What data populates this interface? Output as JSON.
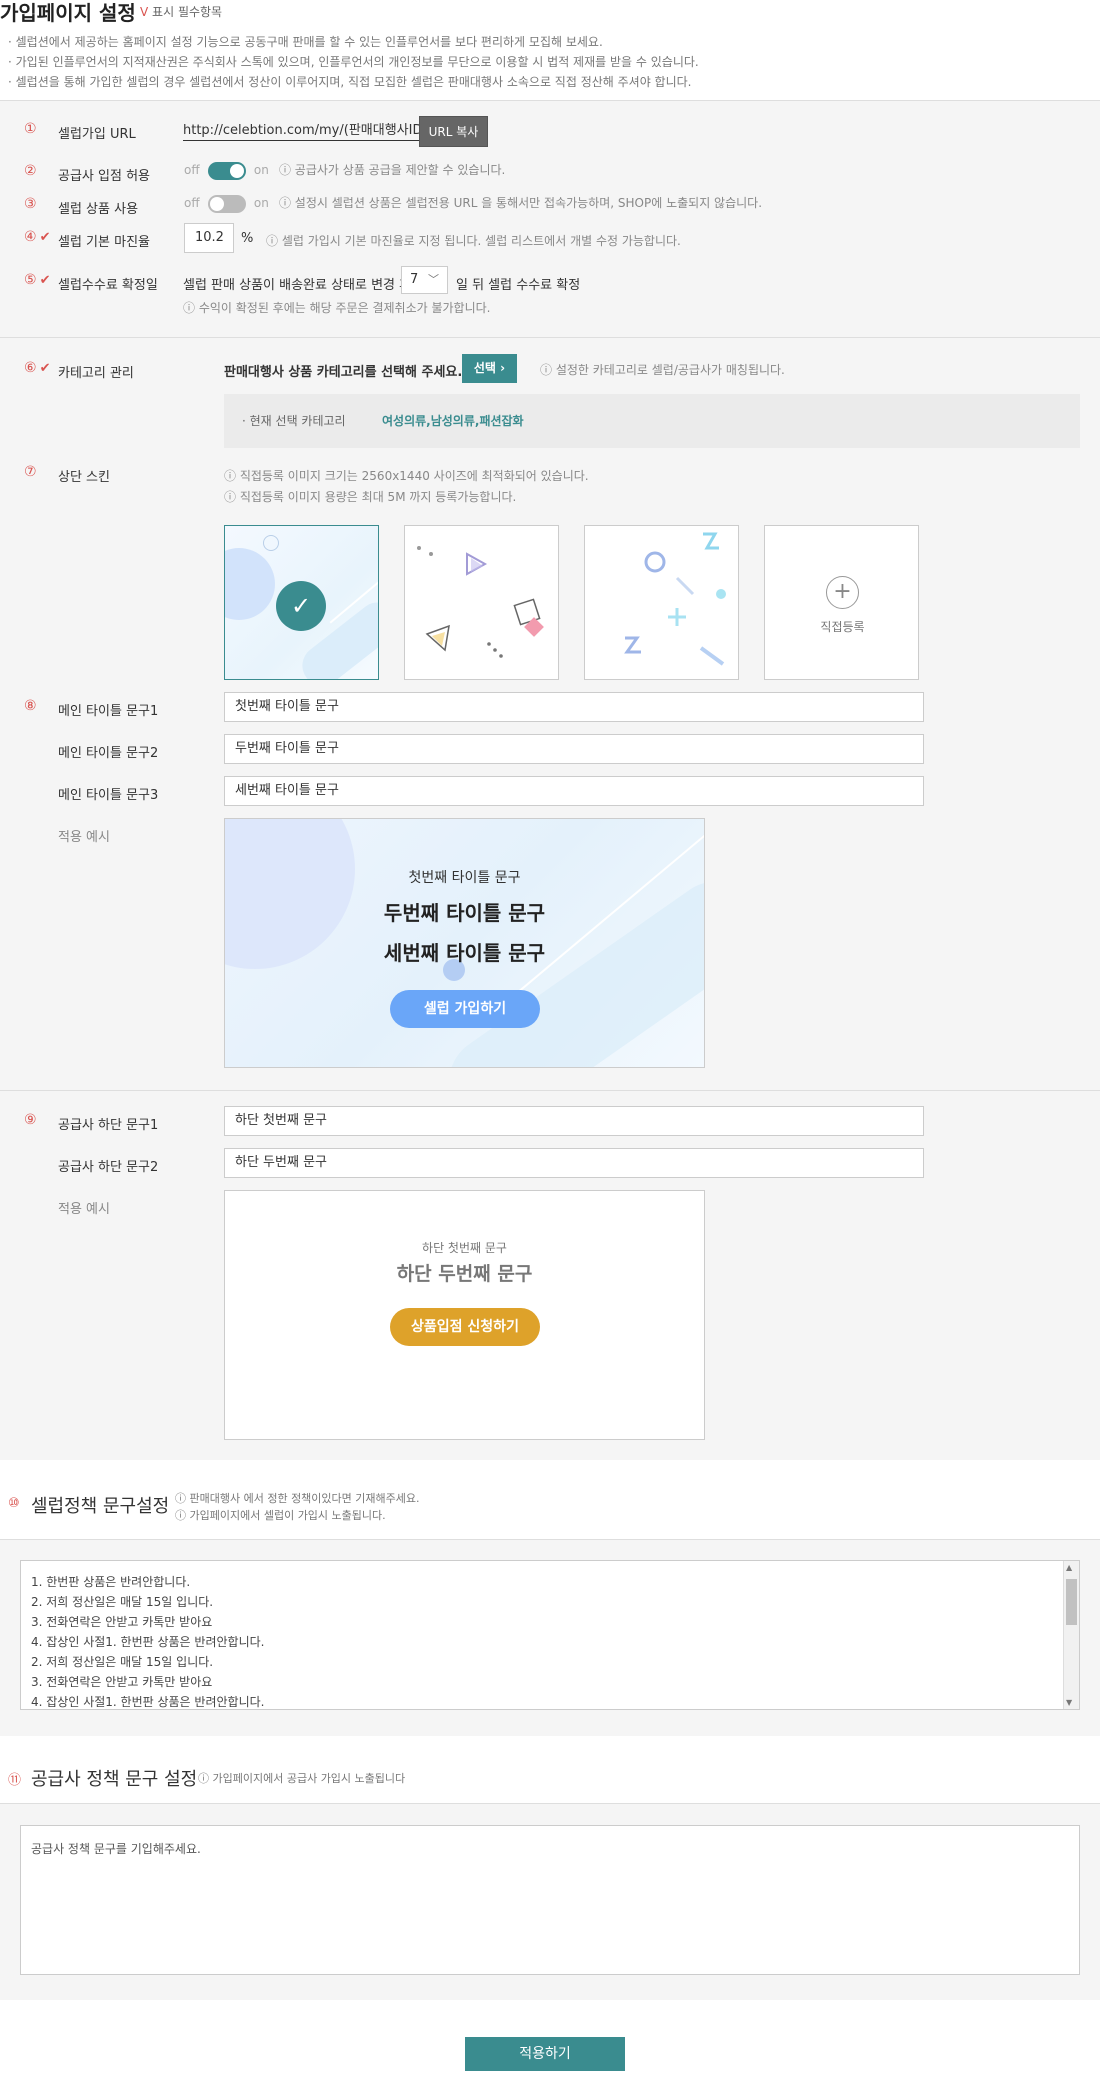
{
  "header": {
    "title": "가입페이지 설정",
    "required_mark": "V",
    "required_label": "표시 필수항목",
    "notes": [
      "· 셀럽션에서 제공하는 홈페이지 설정 기능으로 공동구매 판매를 할 수 있는 인플루언서를 보다 편리하게 모집해 보세요.",
      "· 가입된 인플루언서의 지적재산권은 주식회사 스톡에 있으며, 인플루언서의 개인정보를 무단으로 이용할 시 법적 제재를 받을 수 있습니다.",
      "· 셀럽션을 통해 가입한 셀럽의 경우 셀럽션에서 정산이 이루어지며, 직접 모집한 셀럽은 판매대행사 소속으로 직접 정산해 주셔야 합니다."
    ]
  },
  "s1": {
    "num": "①",
    "label": "셀럽가입 URL",
    "url": "http://celebtion.com/my/(판매대행사ID)",
    "copy_button": "URL 복사"
  },
  "s2": {
    "num": "②",
    "label": "공급사 입점 허용",
    "off": "off",
    "on": "on",
    "note": "ⓘ 공급사가 상품 공급을 제안할 수 있습니다."
  },
  "s3": {
    "num": "③",
    "label": "셀럽 상품 사용",
    "off": "off",
    "on": "on",
    "note": "ⓘ 설정시 셀럽션 상품은 셀럽전용 URL 을 통해서만 접속가능하며, SHOP에 노출되지 않습니다."
  },
  "s4": {
    "num": "④",
    "check": "✔",
    "label": "셀럽 기본 마진율",
    "value": "10.2",
    "unit": "%",
    "note": "ⓘ 셀럽 가입시 기본 마진율로 지정 됩니다. 셀럽 리스트에서 개별 수정 가능합니다."
  },
  "s5": {
    "num": "⑤",
    "check": "✔",
    "label": "셀럽수수료 확정일",
    "text_before": "셀럽 판매 상품이 배송완료 상태로 변경 후",
    "days": "7",
    "text_after": "일 뒤 셀럽 수수료 확정",
    "note": "ⓘ 수익이 확정된 후에는 해당 주문은 결제취소가 불가합니다."
  },
  "s6": {
    "num": "⑥",
    "check": "✔",
    "label": "카테고리 관리",
    "prompt": "판매대행사 상품 카테고리를 선택해 주세요.",
    "select_button": "선택 ›",
    "note": "ⓘ 설정한 카테고리로 셀럽/공급사가 매칭됩니다.",
    "current_label": "· 현재 선택 카테고리",
    "current_value": "여성의류,남성의류,패션잡화"
  },
  "s7": {
    "num": "⑦",
    "label": "상단 스킨",
    "note1": "ⓘ 직접등록 이미지 크기는 2560x1440 사이즈에 최적화되어 있습니다.",
    "note2": "ⓘ 직접등록 이미지 용량은 최대 5M 까지 등록가능합니다.",
    "custom_label": "직접등록"
  },
  "s8": {
    "num": "⑧",
    "label1": "메인 타이틀 문구1",
    "label2": "메인 타이틀 문구2",
    "label3": "메인 타이틀 문구3",
    "value1": "첫번째 타이틀 문구",
    "value2": "두번째 타이틀 문구",
    "value3": "세번째 타이틀 문구",
    "preview_label": "적용 예시",
    "preview_title1": "첫번째 타이틀 문구",
    "preview_title2": "두번째 타이틀 문구",
    "preview_title3": "세번째 타이틀 문구",
    "preview_button": "셀럽 가입하기"
  },
  "s9": {
    "num": "⑨",
    "label1": "공급사 하단 문구1",
    "label2": "공급사 하단 문구2",
    "value1": "하단 첫번째 문구",
    "value2": "하단 두번째 문구",
    "preview_label": "적용 예시",
    "preview_text1": "하단 첫번째 문구",
    "preview_text2": "하단 두번째 문구",
    "preview_button": "상품입점 신청하기"
  },
  "s10": {
    "num": "⑩",
    "title": "셀럽정책 문구설정",
    "note1": "ⓘ 판매대행사 에서 정한 정책이있다면 기재해주세요.",
    "note2": "ⓘ 가입페이지에서 셀럽이 가입시 노출됩니다.",
    "lines": [
      "1. 한번판 상품은 반려안합니다.",
      "2. 저희 정산일은 매달 15일 입니다.",
      "3. 전화연락은 안받고 카톡만 받아요",
      "4. 잡상인 사절1. 한번판 상품은 반려안합니다.",
      "2. 저희 정산일은 매달 15일 입니다.",
      "3. 전화연락은 안받고 카톡만 받아요",
      "4. 잡상인 사절1. 한번판 상품은 반려안합니다."
    ]
  },
  "s11": {
    "num": "⑪",
    "title": "공급사 정책 문구 설정",
    "note": "ⓘ 가입페이지에서 공급사 가입시 노출됩니다",
    "placeholder": "공급사 정책 문구를 기입해주세요."
  },
  "footer": {
    "apply_button": "적용하기"
  },
  "colors": {
    "accent": "#3a8c8f",
    "required": "#d9534f",
    "celeb_button": "#6aa6f8",
    "supplier_button": "#dea22a"
  }
}
